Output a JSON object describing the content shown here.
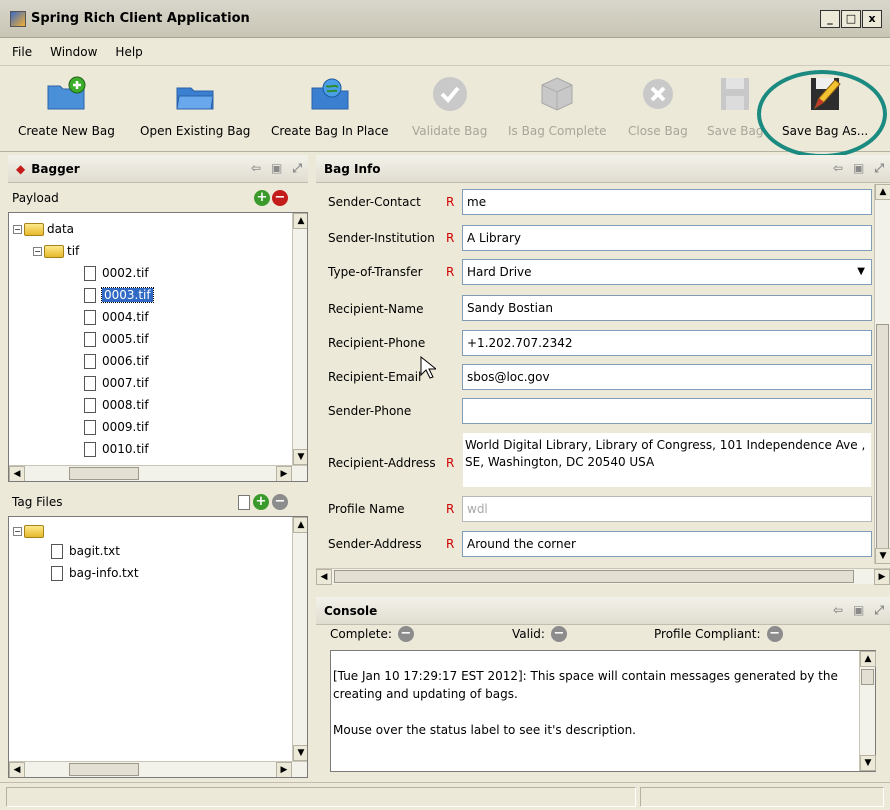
{
  "window": {
    "title": "Spring Rich Client Application",
    "buttons": [
      "_",
      "□",
      "x"
    ]
  },
  "menu": [
    "File",
    "Window",
    "Help"
  ],
  "toolbar": {
    "create_new": "Create New Bag",
    "open_existing": "Open Existing Bag",
    "create_in_place": "Create Bag In Place",
    "validate": "Validate Bag",
    "is_complete": "Is Bag Complete",
    "close": "Close Bag",
    "save": "Save Bag",
    "save_as": "Save Bag As..."
  },
  "bagger": {
    "title": "Bagger",
    "payload_label": "Payload",
    "root": "data",
    "folder": "tif",
    "files": [
      "0002.tif",
      "0003.tif",
      "0004.tif",
      "0005.tif",
      "0006.tif",
      "0007.tif",
      "0008.tif",
      "0009.tif",
      "0010.tif"
    ],
    "selected_file": "0003.tif",
    "tagfiles_label": "Tag Files",
    "tag_files": [
      "bagit.txt",
      "bag-info.txt"
    ]
  },
  "bag_info": {
    "title": "Bag Info",
    "required_marker": "R",
    "fields": [
      {
        "label": "Sender-Contact",
        "required": true,
        "value": "me"
      },
      {
        "label": "Sender-Institution",
        "required": true,
        "value": "A Library"
      },
      {
        "label": "Type-of-Transfer",
        "required": true,
        "value": "Hard Drive"
      },
      {
        "label": "Recipient-Name",
        "required": false,
        "value": "Sandy Bostian"
      },
      {
        "label": "Recipient-Phone",
        "required": false,
        "value": "+1.202.707.2342"
      },
      {
        "label": "Recipient-Email",
        "required": false,
        "value": "sbos@loc.gov"
      },
      {
        "label": "Sender-Phone",
        "required": false,
        "value": ""
      },
      {
        "label": "Recipient-Address",
        "required": true,
        "value": "World Digital Library, Library of Congress, 101 Independence Ave , SE, Washington, DC 20540 USA"
      },
      {
        "label": "Profile Name",
        "required": true,
        "value": "wdl"
      },
      {
        "label": "Sender-Address",
        "required": true,
        "value": "Around the corner"
      }
    ]
  },
  "console": {
    "title": "Console",
    "complete_label": "Complete:",
    "valid_label": "Valid:",
    "profile_label": "Profile Compliant:",
    "message_1": "[Tue Jan 10 17:29:17 EST 2012]: This space will contain messages generated by the creating and updating of bags.",
    "message_2": "Mouse over the status label to see it's description."
  },
  "colors": {
    "accent": "#1b8a80",
    "selection": "#316ac5",
    "required": "#d00000"
  }
}
